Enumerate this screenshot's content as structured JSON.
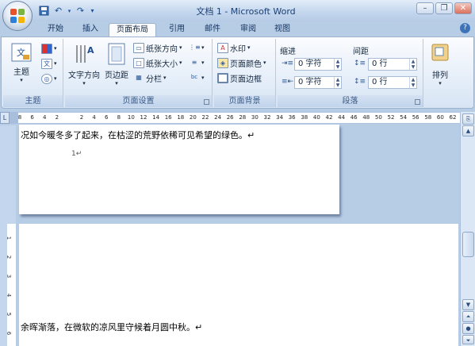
{
  "window": {
    "title": "文档 1 - Microsoft Word"
  },
  "qat": {
    "save": "save-icon",
    "undo": "↶",
    "redo": "↷"
  },
  "tabs": [
    "开始",
    "插入",
    "页面布局",
    "引用",
    "邮件",
    "审阅",
    "视图"
  ],
  "active_tab": "页面布局",
  "ribbon": {
    "themes": {
      "label": "主题",
      "button": "主题"
    },
    "page_setup": {
      "label": "页面设置",
      "text_direction": "文字方向",
      "margins": "页边距",
      "orientation": "纸张方向",
      "size": "纸张大小",
      "columns": "分栏"
    },
    "page_background": {
      "label": "页面背景",
      "watermark": "水印",
      "page_color": "页面颜色",
      "page_border": "页面边框"
    },
    "paragraph": {
      "label": "段落",
      "indent_title": "缩进",
      "spacing_title": "间距",
      "indent_left": "0 字符",
      "indent_right": "0 字符",
      "spacing_before": "0 行",
      "spacing_after": "0 行"
    },
    "arrange": {
      "label": "排列"
    }
  },
  "ruler": {
    "corner": "L",
    "ticks": [
      "8",
      "6",
      "4",
      "2",
      "",
      "2",
      "4",
      "6",
      "8",
      "10",
      "12",
      "14",
      "16",
      "18",
      "20",
      "22",
      "24",
      "26",
      "28",
      "30",
      "32",
      "34",
      "36",
      "38",
      "40",
      "42",
      "44",
      "46",
      "48",
      "50",
      "52",
      "54",
      "56",
      "58",
      "60",
      "62"
    ]
  },
  "vruler": {
    "ticks": [
      "1",
      "2",
      "3",
      "4",
      "5",
      "6"
    ]
  },
  "document": {
    "line1": "况如今暖冬多了起来，在枯涩的荒野依稀可见希望的绿色。↵",
    "page_mark": "1↵",
    "line2": "余晖渐落，在微软的凉风里守候着月圆中秋。↵"
  },
  "colors": {
    "accent": "#3f73b8",
    "ribbon_bg": "#dfe9f5",
    "workspace": "#b7cce5"
  }
}
